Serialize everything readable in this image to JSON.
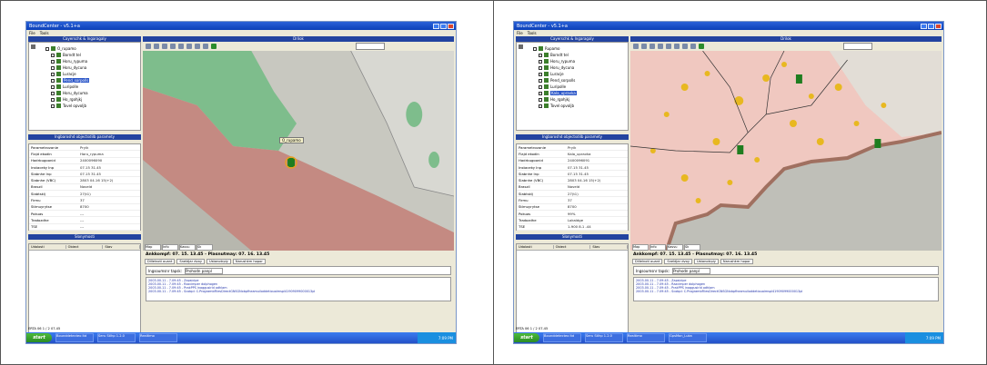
{
  "screens": [
    {
      "window_title": "BoundCenter - v5.1+a",
      "menu": [
        "File",
        "Tools"
      ],
      "layers_panel_title": "Cayerschk & Ingaragaly",
      "layers": [
        {
          "label": "O_rupamo",
          "selected": false,
          "sub": false
        },
        {
          "label": "Borndt tel",
          "selected": false,
          "sub": true
        },
        {
          "label": "Horu_rypuma",
          "selected": false,
          "sub": true
        },
        {
          "label": "Horu_dycuna",
          "selected": false,
          "sub": true
        },
        {
          "label": "Luracje",
          "selected": false,
          "sub": true
        },
        {
          "label": "Pend_sorpolls",
          "selected": true,
          "sub": true
        },
        {
          "label": "Luripolle",
          "selected": false,
          "sub": true
        },
        {
          "label": "Horu_dycuma",
          "selected": false,
          "sub": true
        },
        {
          "label": "Ho_rgohjkj",
          "selected": false,
          "sub": true
        },
        {
          "label": "Tovel opvoljb",
          "selected": false,
          "sub": true
        }
      ],
      "props_panel_title": "Ingbaroshd objectsdilb paramety",
      "props": [
        [
          "Parametrovanie",
          "Pryik"
        ],
        [
          "Flajd ekodin",
          "Horu_rypuma"
        ],
        [
          "Hadrbugoonid",
          "2400096090"
        ],
        [
          "Instaceky Inp",
          "07.15 31.45"
        ],
        [
          "Slabnhe Inp",
          "07.15 31.45"
        ],
        [
          "Slabnhe (VBC)",
          "2803 04.16 15(+2)"
        ],
        [
          "Braszil",
          "Noveld"
        ],
        [
          "Slabtsklj",
          "27(t1)"
        ],
        [
          "Firmu",
          "37"
        ],
        [
          "Stlmuyrytse",
          "8700"
        ],
        [
          "Pokuas",
          "---"
        ],
        [
          "Tradozdhe",
          "---"
        ],
        [
          "TSE",
          "---"
        ]
      ],
      "messages_panel_title": "Slonymosti",
      "message_columns": [
        "Udalosti",
        "Obiect",
        "Stav"
      ],
      "map_title": "Drilok",
      "map_tabs": [
        "Map",
        "Info",
        "Kasvu",
        "Sk"
      ],
      "tooltip": "O_rupamo",
      "date_line": "Ankkompf: 07. 15. 13.45 - Plasnutmay: 07. 16. 13.45",
      "bottom_tabs": [
        "Dillelnoti ouant",
        "Sneldjar dvoy",
        "Ustanotrpiy",
        "Narushkm hopor"
      ],
      "filter_label": "Ingsoumsnr tapsk:",
      "filter_value": "Prohodn panpl",
      "log_lines": [
        "2003.00.11 - 7.09:45 - Zapsicipe",
        "2003.00.11 - 7.09:45 - Razcimper dolphogen",
        "2003.00.11 - 7.09:45 - PrakPPS inaggusirld odhlam",
        "2003.00.11 - 7.09:45 - Scobpl: C.ProgrambFilesDirectGNSGNxbpfheamuiloddetiouaimspl41909099000013pl"
      ],
      "status_text": "ERTA 06 1 / 2 07.45",
      "start_label": "start",
      "taskbar_items": [
        "Bounddetecteo ltd",
        "Seru Stlhp 1.2.0",
        "Realtimo"
      ],
      "tray_time": "7:09 PM"
    },
    {
      "window_title": "BoundCenter - v5.1+a",
      "menu": [
        "File",
        "Tools"
      ],
      "layers_panel_title": "Cayerschk & Ingaragaly",
      "layers": [
        {
          "label": "Rupamo",
          "selected": false,
          "sub": false
        },
        {
          "label": "Borndt tel",
          "selected": false,
          "sub": true
        },
        {
          "label": "Horu_rypuma",
          "selected": false,
          "sub": true
        },
        {
          "label": "Horu_dycuna",
          "selected": false,
          "sub": true
        },
        {
          "label": "Luracje",
          "selected": false,
          "sub": true
        },
        {
          "label": "Pend_sorpolls",
          "selected": false,
          "sub": true
        },
        {
          "label": "Luripolle",
          "selected": false,
          "sub": true
        },
        {
          "label": "Kala_upravka",
          "selected": true,
          "sub": true
        },
        {
          "label": "Ho_rgohjkj",
          "selected": false,
          "sub": true
        },
        {
          "label": "Tovel opvoljb",
          "selected": false,
          "sub": true
        }
      ],
      "props_panel_title": "Ingbaroshd objectsdilb paramety",
      "props": [
        [
          "Parametrovanie",
          "Pryik"
        ],
        [
          "Flajd ekodin",
          "Kala_upravka"
        ],
        [
          "Hadrbugoonid",
          "2400096091"
        ],
        [
          "Instaceky Inp",
          "07.15 31.45"
        ],
        [
          "Slabnhe Inp",
          "07.15 31.45"
        ],
        [
          "Slabnhe (VBC)",
          "2803 04.16 15(+2)"
        ],
        [
          "Braszil",
          "Noveld"
        ],
        [
          "Slabtsklj",
          "27(t1)"
        ],
        [
          "Firmu",
          "37"
        ],
        [
          "Stlmuyrytse",
          "8700"
        ],
        [
          "Pokuas",
          "99%"
        ],
        [
          "Tradozdhe",
          "Lokaldge"
        ],
        [
          "TSE",
          "1-900 8.1 -44"
        ]
      ],
      "messages_panel_title": "Slonymosti",
      "message_columns": [
        "Udalosti",
        "Obiect",
        "Stav"
      ],
      "map_title": "Drilok",
      "map_tabs": [
        "Map",
        "Info",
        "Kasvu",
        "Sk"
      ],
      "tooltip": "",
      "date_line": "Ankkompf: 07. 15. 13.45 - Plasnutmay: 07. 16. 13.45",
      "bottom_tabs": [
        "Dillelnoti ouant",
        "Sneldjar dvoy",
        "Ustanotrpiy",
        "Narushkm hopor"
      ],
      "filter_label": "Ingsoumsnr tapsk:",
      "filter_value": "Prohodn panpl",
      "log_lines": [
        "2003.00.11 - 7.09:45 - Zapsicipe",
        "2003.00.11 - 7.09:45 - Razcimper dolphogen",
        "2003.00.11 - 7.09:45 - PrakPPS inaggusirld odhlam",
        "2003.00.11 - 7.09:45 - Scobpl: C.ProgrambFilesDirectGNSGNxbpfheamuiloddetiouaimspl41909099000013pl"
      ],
      "status_text": "ERTA 06 1 / 2 07.45",
      "start_label": "start",
      "taskbar_items": [
        "Bounddetecteo ltd",
        "Seru Stlhp 1.2.0",
        "Realtimo",
        "GpsMon_Luka"
      ],
      "tray_time": "7:09 PM"
    }
  ],
  "colors": {
    "titlebar": "#0a3fb8",
    "panel_header": "#2344a0",
    "map_green": "#7ebd8c",
    "map_red": "#c48a82",
    "map_grey": "#c8c8c0",
    "map_pink": "#f0c8c0",
    "map_border": "#a07060",
    "taskbar": "#2451c8"
  }
}
